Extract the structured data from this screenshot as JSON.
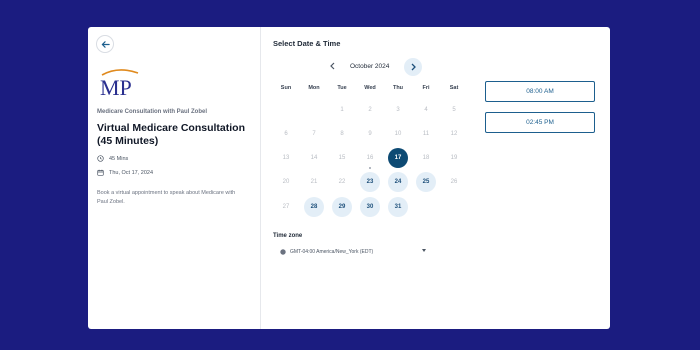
{
  "host_name": "Medicare Consultation with Paul Zobel",
  "event_title": "Virtual Medicare Consultation (45 Minutes)",
  "duration": "45 Mins",
  "date": "Thu, Oct 17, 2024",
  "description": "Book a virtual appointment to speak about Medicare with Paul Zobel.",
  "logo_text": "MP",
  "calendar": {
    "heading": "Select Date & Time",
    "month": "October 2024",
    "weekdays": [
      "Sun",
      "Mon",
      "Tue",
      "Wed",
      "Thu",
      "Fri",
      "Sat"
    ],
    "first_weekday_index": 2,
    "days_in_month": 31,
    "selected_day": 17,
    "today_day": 16,
    "available_days": [
      23,
      24,
      25,
      28,
      29,
      30,
      31
    ]
  },
  "timezone": {
    "label": "Time zone",
    "value": "GMT-04:00 America/New_York (EDT)"
  },
  "time_slots": [
    "08:00 AM",
    "02:45 PM"
  ],
  "colors": {
    "page_bg": "#1b1c80",
    "accent": "#0d4a73",
    "available_day_bg": "#e3eef7",
    "slot_border": "#1d5f8e"
  }
}
